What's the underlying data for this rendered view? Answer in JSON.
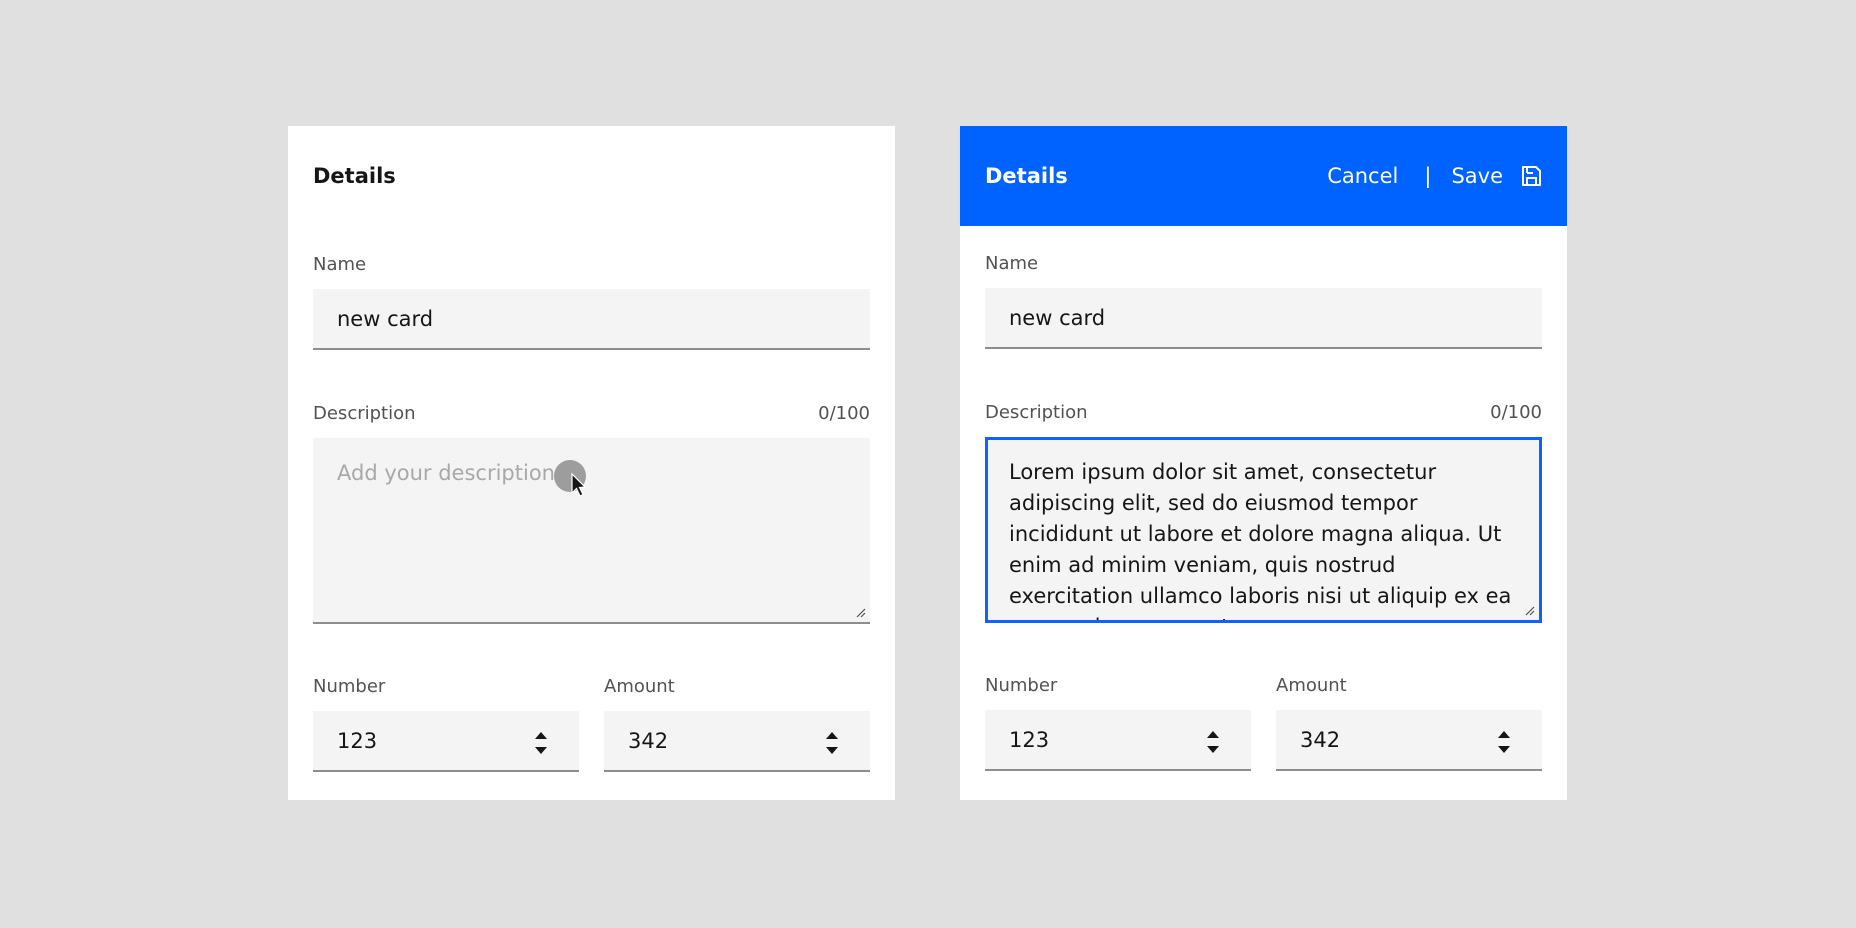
{
  "left_card": {
    "title": "Details",
    "name": {
      "label": "Name",
      "value": "new card"
    },
    "description": {
      "label": "Description",
      "counter": "0/100",
      "placeholder": "Add your description"
    },
    "number": {
      "label": "Number",
      "value": "123"
    },
    "amount": {
      "label": "Amount",
      "value": "342"
    }
  },
  "right_card": {
    "title": "Details",
    "cancel_label": "Cancel",
    "separator": "|",
    "save_label": "Save",
    "header_color": "#0062ff",
    "name": {
      "label": "Name",
      "value": "new card"
    },
    "description": {
      "label": "Description",
      "counter": "0/100",
      "value": "Lorem ipsum dolor sit amet, consectetur adipiscing elit, sed do eiusmod tempor incididunt ut labore et dolore magna aliqua. Ut enim ad minim veniam, quis nostrud exercitation ullamco laboris nisi ut aliquip ex ea commodo consequat."
    },
    "number": {
      "label": "Number",
      "value": "123"
    },
    "amount": {
      "label": "Amount",
      "value": "342"
    }
  },
  "icons": {
    "save": "save-icon",
    "stepper": "stepper-icon",
    "resize": "resize-grip-icon",
    "cursor": "mouse-pointer-icon"
  }
}
